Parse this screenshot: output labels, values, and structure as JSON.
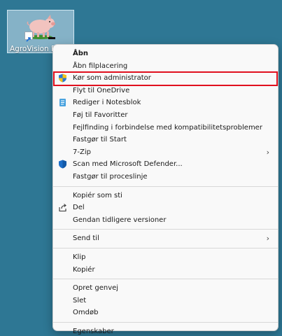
{
  "desktop": {
    "background": "#2e7794",
    "shortcut_label": "AgroVision Pig"
  },
  "context_menu": {
    "groups": [
      [
        {
          "label": "Åbn",
          "bold": true,
          "icon": null
        },
        {
          "label": "Åbn filplacering",
          "icon": null
        },
        {
          "label": "Kør som administrator",
          "icon": "uac-shield-icon"
        },
        {
          "label": "Flyt til OneDrive",
          "icon": null
        },
        {
          "label": "Rediger i Notesblok",
          "icon": "notepad-icon"
        },
        {
          "label": "Føj til Favoritter",
          "icon": null
        },
        {
          "label": "Fejlfinding i forbindelse med kompatibilitetsproblemer",
          "icon": null
        },
        {
          "label": "Fastgør til Start",
          "icon": null
        },
        {
          "label": "7-Zip",
          "icon": null,
          "submenu": true
        },
        {
          "label": "Scan med Microsoft Defender...",
          "icon": "defender-shield-icon"
        },
        {
          "label": "Fastgør til proceslinje",
          "icon": null
        }
      ],
      [
        {
          "label": "Kopiér som sti",
          "icon": null
        },
        {
          "label": "Del",
          "icon": "share-icon"
        },
        {
          "label": "Gendan tidligere versioner",
          "icon": null
        }
      ],
      [
        {
          "label": "Send til",
          "icon": null,
          "submenu": true
        }
      ],
      [
        {
          "label": "Klip",
          "icon": null
        },
        {
          "label": "Kopiér",
          "icon": null
        }
      ],
      [
        {
          "label": "Opret genvej",
          "icon": null
        },
        {
          "label": "Slet",
          "icon": null
        },
        {
          "label": "Omdøb",
          "icon": null
        }
      ],
      [
        {
          "label": "Egenskaber",
          "icon": null
        }
      ]
    ],
    "highlighted_item": "Kør som administrator",
    "highlight_color": "#e0101e"
  }
}
